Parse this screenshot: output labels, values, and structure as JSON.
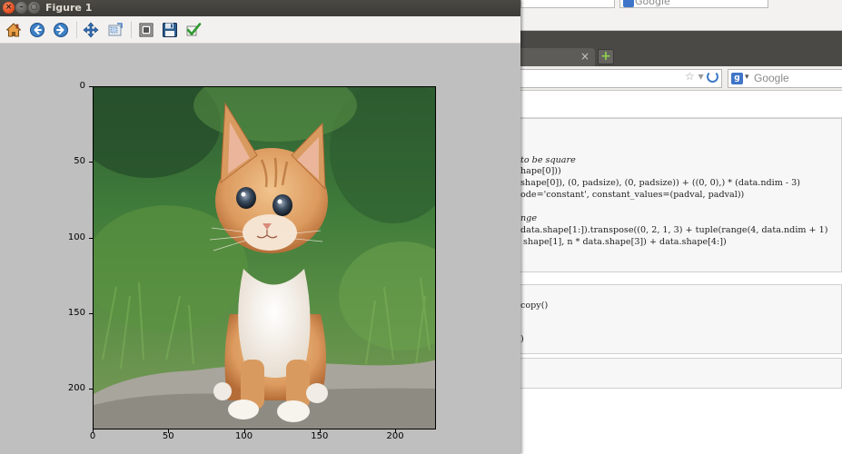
{
  "figure_window": {
    "title": "Figure 1",
    "controls": {
      "close": "×",
      "minimize": "–",
      "maximize": "○"
    }
  },
  "toolbar": {
    "tools": [
      {
        "name": "home",
        "icon": "home-icon"
      },
      {
        "name": "back",
        "icon": "back-arrow-icon"
      },
      {
        "name": "forward",
        "icon": "forward-arrow-icon"
      },
      {
        "name": "pan",
        "icon": "pan-arrows-icon"
      },
      {
        "name": "zoom",
        "icon": "zoom-rect-icon"
      },
      {
        "name": "configure-subplots",
        "icon": "subplots-icon"
      },
      {
        "name": "save",
        "icon": "floppy-disk-icon"
      },
      {
        "name": "edit-parameters",
        "icon": "checkmark-icon"
      }
    ]
  },
  "plot": {
    "image_subject": "kitten",
    "yticks": [
      "0",
      "50",
      "100",
      "150",
      "200"
    ],
    "xticks": [
      "0",
      "50",
      "100",
      "150",
      "200"
    ],
    "xlim": [
      0,
      227
    ],
    "ylim": [
      227,
      0
    ]
  },
  "browser": {
    "top_search_label": "Google",
    "tab_close": "×",
    "new_tab": "+",
    "url_star": "☆ ▾",
    "search_label": "Google",
    "search_engine_caret": "▾",
    "code_cell_1": [
      {
        "text": "to be square",
        "kind": "comment"
      },
      {
        "text": "hape[0]))",
        "kind": "code"
      },
      {
        "text": "shape[0]), (0, padsize), (0, padsize)) + ((0, 0),) * (data.ndim - 3)",
        "kind": "code"
      },
      {
        "text": "ode='constant', constant_values=(padval, padval))",
        "kind": "code"
      },
      {
        "text": "",
        "kind": "code"
      },
      {
        "text": "nge",
        "kind": "comment"
      },
      {
        "text": "data.shape[1:]).transpose((0, 2, 1, 3) + tuple(range(4, data.ndim + 1)",
        "kind": "code"
      },
      {
        "text": " shape[1], n * data.shape[3]) + data.shape[4:])",
        "kind": "code"
      }
    ],
    "code_cell_2": [
      "copy()",
      "",
      "",
      ")"
    ]
  }
}
